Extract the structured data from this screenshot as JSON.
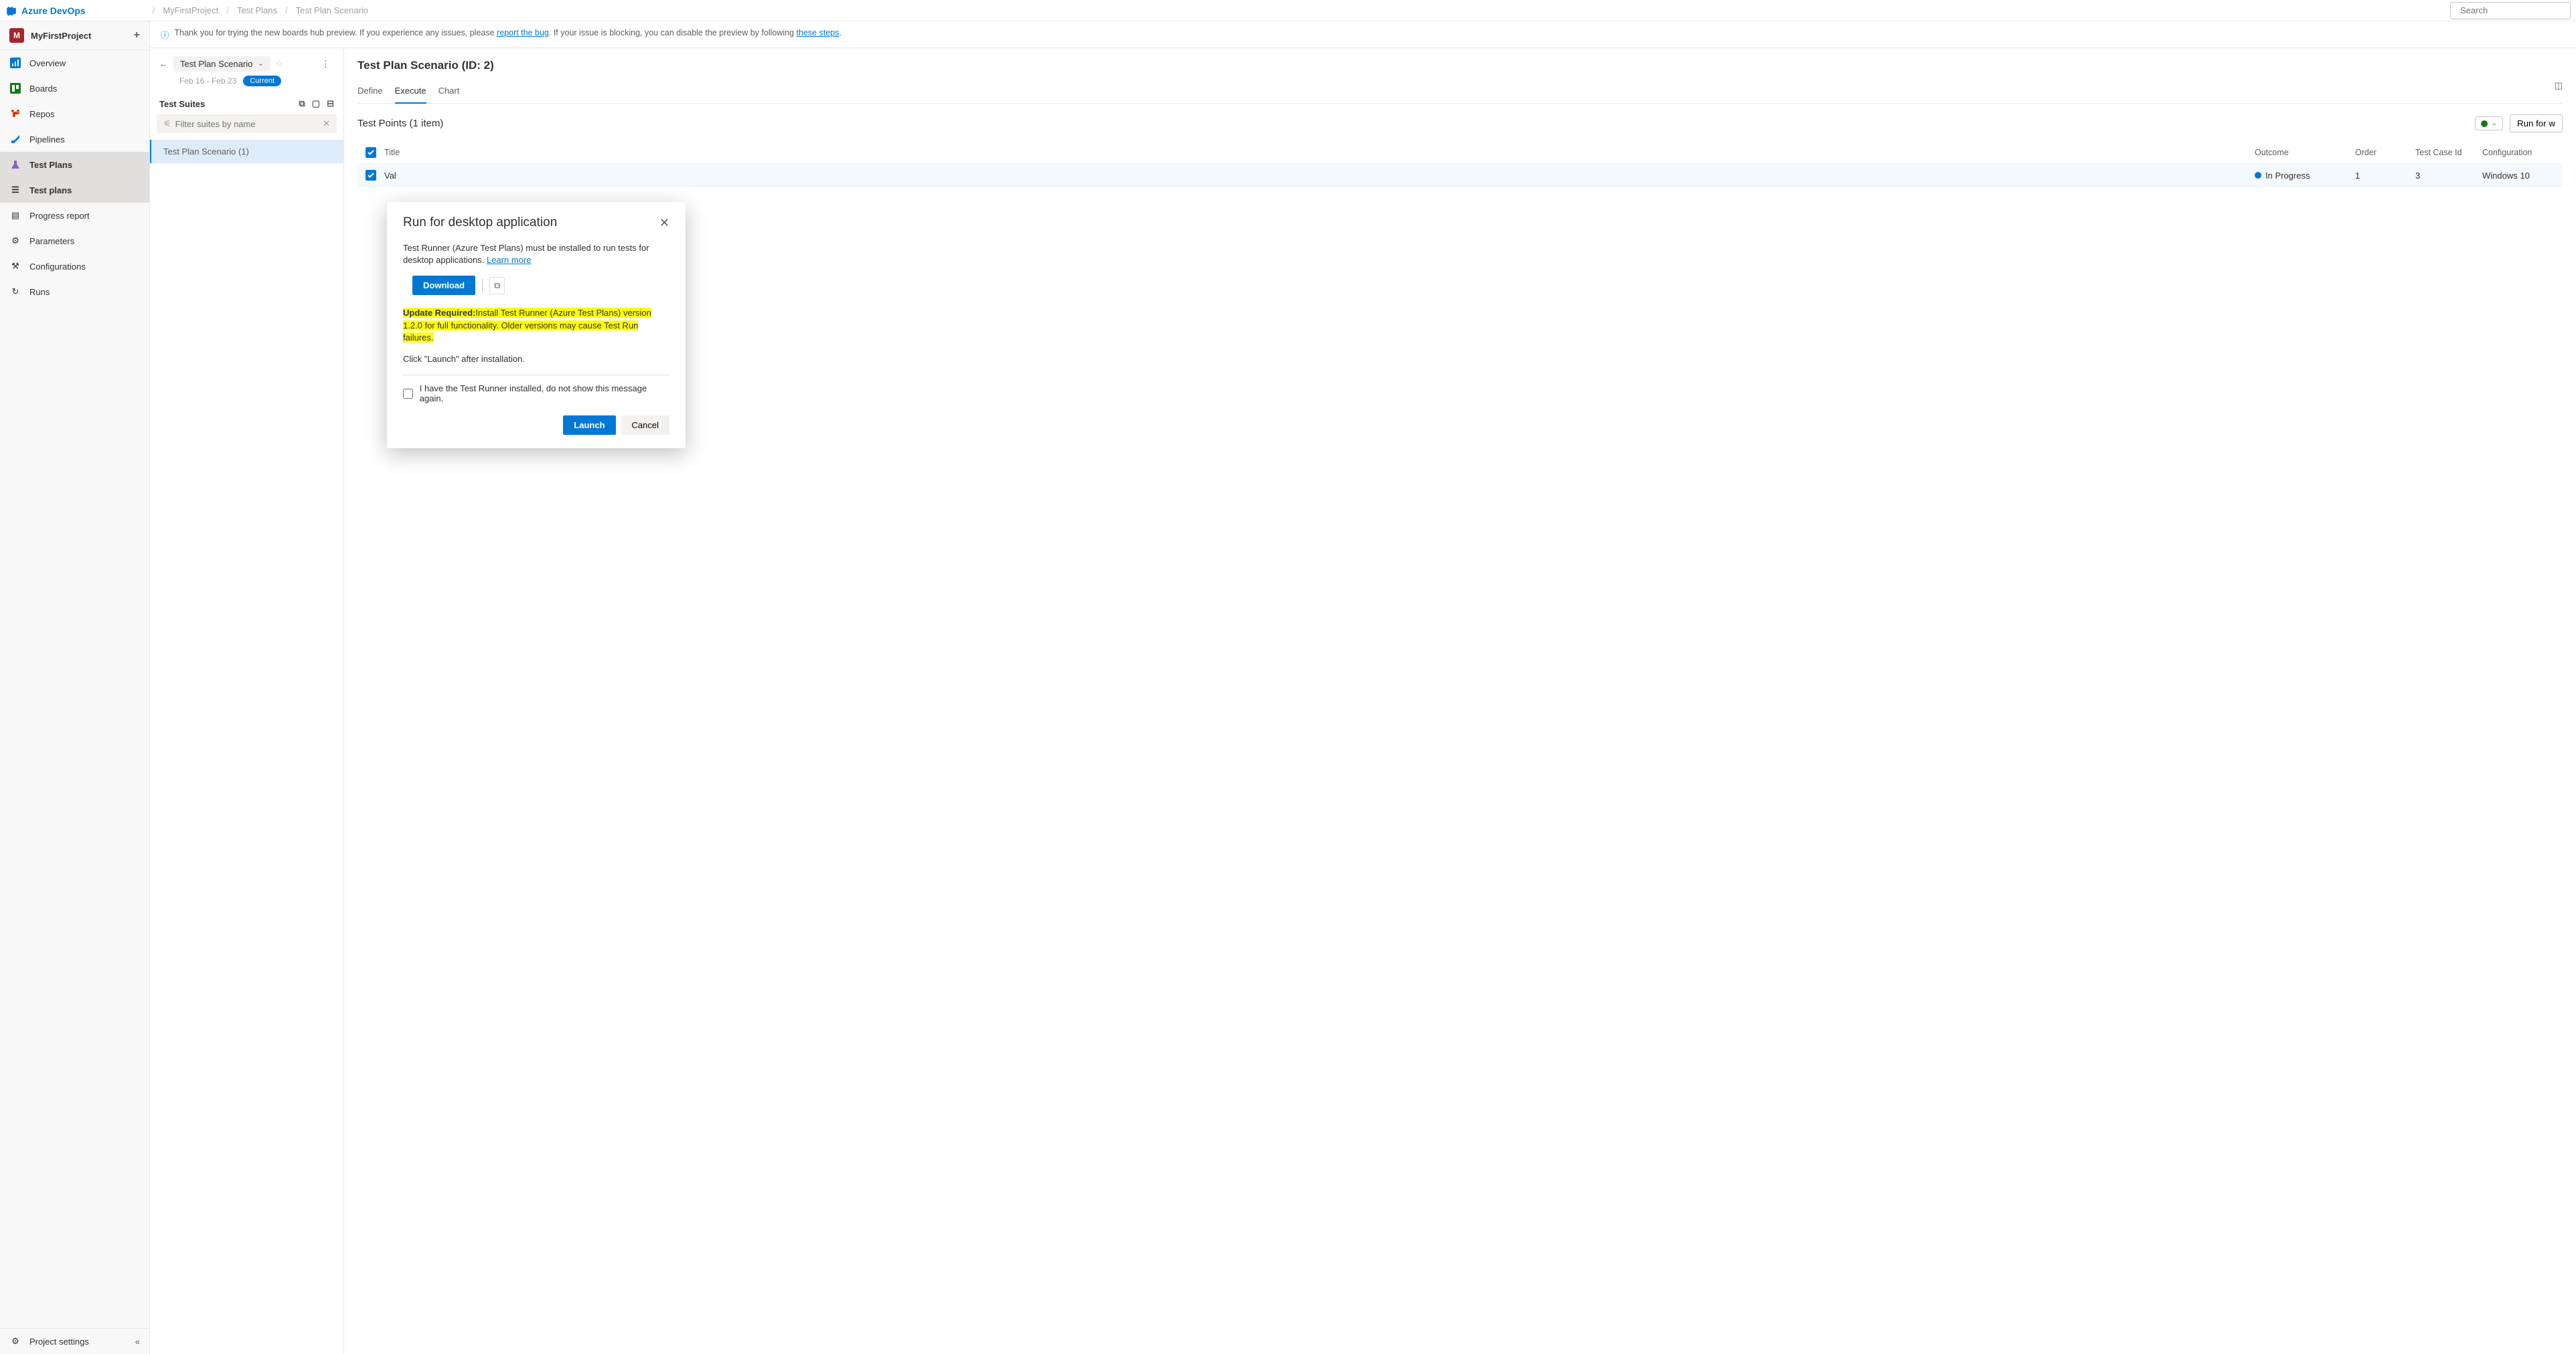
{
  "brand": "Azure DevOps",
  "breadcrumb": {
    "project": "MyFirstProject",
    "area": "Test Plans",
    "item": "Test Plan Scenario"
  },
  "search": {
    "placeholder": "Search"
  },
  "project": {
    "initial": "M",
    "name": "MyFirstProject"
  },
  "nav": {
    "overview": "Overview",
    "boards": "Boards",
    "repos": "Repos",
    "pipelines": "Pipelines",
    "testplans": "Test Plans",
    "sub_testplans": "Test plans",
    "sub_progress": "Progress report",
    "sub_params": "Parameters",
    "sub_configs": "Configurations",
    "sub_runs": "Runs",
    "settings": "Project settings"
  },
  "banner": {
    "pre": "Thank you for trying the new boards hub preview. If you experience any issues, please ",
    "link1": "report the bug",
    "mid": ". If your issue is blocking, you can disable the preview by following ",
    "link2": "these steps",
    "post": "."
  },
  "plan": {
    "name": "Test Plan Scenario",
    "dates": "Feb 16 - Feb 23",
    "pill": "Current"
  },
  "suites": {
    "header": "Test Suites",
    "filter_placeholder": "Filter suites by name",
    "item": "Test Plan Scenario (1)"
  },
  "main": {
    "title": "Test Plan Scenario (ID: 2)",
    "tabs": {
      "define": "Define",
      "execute": "Execute",
      "chart": "Chart"
    }
  },
  "points": {
    "header": "Test Points (1 item)",
    "run_btn": "Run for w",
    "columns": {
      "title": "Title",
      "outcome": "Outcome",
      "order": "Order",
      "tcid": "Test Case Id",
      "config": "Configuration"
    },
    "row": {
      "title": "Val",
      "outcome": "In Progress",
      "order": "1",
      "tcid": "3",
      "config": "Windows 10"
    }
  },
  "modal": {
    "title": "Run for desktop application",
    "intro_pre": "Test Runner (Azure Test Plans) must be installed to run tests for desktop applications. ",
    "learn_more": "Learn more",
    "download": "Download",
    "update_label": "Update Required:",
    "update_msg": "Install Test Runner (Azure Test Plans) version 1.2.0 for full functionality. Older versions may cause Test Run failures.",
    "launch_hint": "Click \"Launch\" after installation.",
    "dont_show": "I have the Test Runner installed, do not show this message again.",
    "launch": "Launch",
    "cancel": "Cancel"
  }
}
